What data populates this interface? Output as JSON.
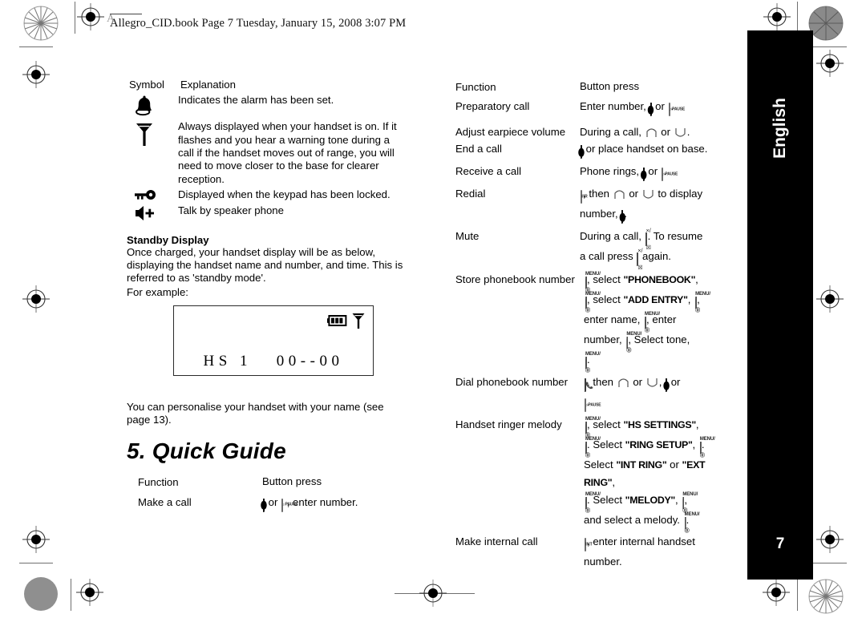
{
  "header": {
    "slug": "Allegro_CID.book  Page 7  Tuesday, January 15, 2008  3:07 PM",
    "corner_letter": "A"
  },
  "tab": {
    "language_label": "English",
    "page_number": "7"
  },
  "symbol_table": {
    "col_symbol_header": "Symbol",
    "col_explanation_header": "Explanation",
    "rows": [
      {
        "icon": "bell-icon",
        "text": "Indicates the alarm has been set."
      },
      {
        "icon": "antenna-icon",
        "text": "Always displayed when your handset is on. If it flashes and you hear a warning tone during a call if the handset moves out of range, you will need to move closer to the base for clearer reception."
      },
      {
        "icon": "key-lock-icon",
        "text": "Displayed when the keypad has been locked."
      },
      {
        "icon": "speakerphone-icon",
        "text": "Talk by speaker phone"
      }
    ]
  },
  "standby": {
    "heading": "Standby Display",
    "paragraph": "Once charged, your handset display will be as below, displaying the handset name and number, and time. This is referred to as 'standby mode'.",
    "example_label": "For example:",
    "lcd": {
      "battery_icon": "battery-full-icon",
      "signal_icon": "antenna-icon",
      "text": "HS 1   00--00"
    },
    "after_text": "You can personalise your handset with your name (see page 13)."
  },
  "section": {
    "heading": "5. Quick Guide"
  },
  "quick_guide_left": {
    "col_function_header": "Function",
    "col_button_header": "Button press",
    "rows": [
      {
        "function": "Make a call",
        "parts": [
          {
            "type": "key",
            "key": "talk",
            "glyph": "⬮"
          },
          {
            "type": "text",
            "text": " or "
          },
          {
            "type": "key",
            "key": "speaker",
            "label": "PAUSE"
          },
          {
            "type": "text",
            "text": ", enter number."
          }
        ]
      }
    ]
  },
  "quick_guide_right": {
    "col_function_header": "Function",
    "col_button_header": "Button press",
    "rows": [
      {
        "function": "Preparatory call",
        "lines": [
          [
            {
              "type": "text",
              "text": "Enter number, "
            },
            {
              "type": "key",
              "key": "talk"
            },
            {
              "type": "text",
              "text": " or "
            },
            {
              "type": "key",
              "key": "speaker",
              "label": "PAUSE"
            },
            {
              "type": "text",
              "text": "."
            }
          ]
        ]
      },
      {
        "function": "Adjust earpiece volume",
        "lines": [
          [
            {
              "type": "text",
              "text": "During a call, "
            },
            {
              "type": "key",
              "key": "up"
            },
            {
              "type": "text",
              "text": " or "
            },
            {
              "type": "key",
              "key": "down"
            },
            {
              "type": "text",
              "text": "."
            }
          ]
        ]
      },
      {
        "function": "End a call",
        "lines": [
          [
            {
              "type": "key",
              "key": "talk"
            },
            {
              "type": "text",
              "text": " or place handset on base."
            }
          ]
        ]
      },
      {
        "function": "Receive a call",
        "lines": [
          [
            {
              "type": "text",
              "text": "Phone rings, "
            },
            {
              "type": "key",
              "key": "talk"
            },
            {
              "type": "text",
              "text": " or "
            },
            {
              "type": "key",
              "key": "speaker",
              "label": "PAUSE"
            },
            {
              "type": "text",
              "text": "."
            }
          ]
        ]
      },
      {
        "function": "Redial",
        "lines": [
          [
            {
              "type": "key",
              "key": "hash",
              "label": "#/R"
            },
            {
              "type": "text",
              "text": ", then "
            },
            {
              "type": "key",
              "key": "up"
            },
            {
              "type": "text",
              "text": " or "
            },
            {
              "type": "key",
              "key": "down"
            },
            {
              "type": "text",
              "text": " to display"
            }
          ],
          [
            {
              "type": "text",
              "text": "number, "
            },
            {
              "type": "key",
              "key": "talk"
            },
            {
              "type": "text",
              "text": "."
            }
          ]
        ]
      },
      {
        "function": "Mute",
        "lines": [
          [
            {
              "type": "text",
              "text": "During a call, "
            },
            {
              "type": "key",
              "key": "mute",
              "label": "×/☒"
            },
            {
              "type": "text",
              "text": ". To resume"
            }
          ],
          [
            {
              "type": "text",
              "text": "a call press "
            },
            {
              "type": "key",
              "key": "mute",
              "label": "×/☒"
            },
            {
              "type": "text",
              "text": " again."
            }
          ]
        ]
      },
      {
        "function": "Store phonebook number",
        "lines": [
          [
            {
              "type": "key",
              "key": "menu",
              "label": "MENU/⒪"
            },
            {
              "type": "text",
              "text": ", select "
            },
            {
              "type": "menuword",
              "text": "\"PHONEBOOK\""
            },
            {
              "type": "text",
              "text": ","
            }
          ],
          [
            {
              "type": "key",
              "key": "menu",
              "label": "MENU/⒪"
            },
            {
              "type": "text",
              "text": ", select "
            },
            {
              "type": "menuword",
              "text": "\"ADD ENTRY\""
            },
            {
              "type": "text",
              "text": ", "
            },
            {
              "type": "key",
              "key": "menu",
              "label": "MENU/⒪"
            },
            {
              "type": "text",
              "text": ","
            }
          ],
          [
            {
              "type": "text",
              "text": "enter name, "
            },
            {
              "type": "key",
              "key": "menu",
              "label": "MENU/⒪"
            },
            {
              "type": "text",
              "text": ", enter"
            }
          ],
          [
            {
              "type": "text",
              "text": "number, "
            },
            {
              "type": "key",
              "key": "menu",
              "label": "MENU/⒪"
            },
            {
              "type": "text",
              "text": ", Select tone,"
            }
          ],
          [
            {
              "type": "key",
              "key": "menu",
              "label": "MENU/⒪"
            },
            {
              "type": "text",
              "text": "."
            }
          ]
        ]
      },
      {
        "function": "Dial phonebook number",
        "lines": [
          [
            {
              "type": "key",
              "key": "phonebook",
              "label": "☎"
            },
            {
              "type": "text",
              "text": ", then "
            },
            {
              "type": "key",
              "key": "up"
            },
            {
              "type": "text",
              "text": " or "
            },
            {
              "type": "key",
              "key": "down"
            },
            {
              "type": "text",
              "text": ", "
            },
            {
              "type": "key",
              "key": "talk"
            },
            {
              "type": "text",
              "text": " or"
            }
          ],
          [
            {
              "type": "key",
              "key": "speaker",
              "label": "PAUSE"
            },
            {
              "type": "text",
              "text": "."
            }
          ]
        ]
      },
      {
        "function": "Handset ringer melody",
        "lines": [
          [
            {
              "type": "key",
              "key": "menu",
              "label": "MENU/⒪"
            },
            {
              "type": "text",
              "text": ", select "
            },
            {
              "type": "menuword",
              "text": "\"HS SETTINGS\""
            },
            {
              "type": "text",
              "text": ","
            }
          ],
          [
            {
              "type": "key",
              "key": "menu",
              "label": "MENU/⒪"
            },
            {
              "type": "text",
              "text": ". Select "
            },
            {
              "type": "menuword",
              "text": "\"RING SETUP\""
            },
            {
              "type": "text",
              "text": ", "
            },
            {
              "type": "key",
              "key": "menu",
              "label": "MENU/⒪"
            },
            {
              "type": "text",
              "text": "."
            }
          ],
          [
            {
              "type": "text",
              "text": "Select "
            },
            {
              "type": "menuword",
              "text": "\"INT RING\""
            },
            {
              "type": "text",
              "text": " or "
            },
            {
              "type": "menuword",
              "text": "\"EXT RING\""
            },
            {
              "type": "text",
              "text": ","
            }
          ],
          [
            {
              "type": "key",
              "key": "menu",
              "label": "MENU/⒪"
            },
            {
              "type": "text",
              "text": ". Select "
            },
            {
              "type": "menuword",
              "text": "\"MELODY\""
            },
            {
              "type": "text",
              "text": ", "
            },
            {
              "type": "key",
              "key": "menu",
              "label": "MENU/⒪"
            },
            {
              "type": "text",
              "text": ","
            }
          ],
          [
            {
              "type": "text",
              "text": "and select a melody. "
            },
            {
              "type": "key",
              "key": "menu",
              "label": "MENU/⒪"
            },
            {
              "type": "text",
              "text": "."
            }
          ]
        ]
      },
      {
        "function": "Make internal call",
        "lines": [
          [
            {
              "type": "key",
              "key": "int",
              "label": "INT"
            },
            {
              "type": "text",
              "text": ", enter internal handset"
            }
          ],
          [
            {
              "type": "text",
              "text": "number."
            }
          ]
        ]
      }
    ]
  }
}
